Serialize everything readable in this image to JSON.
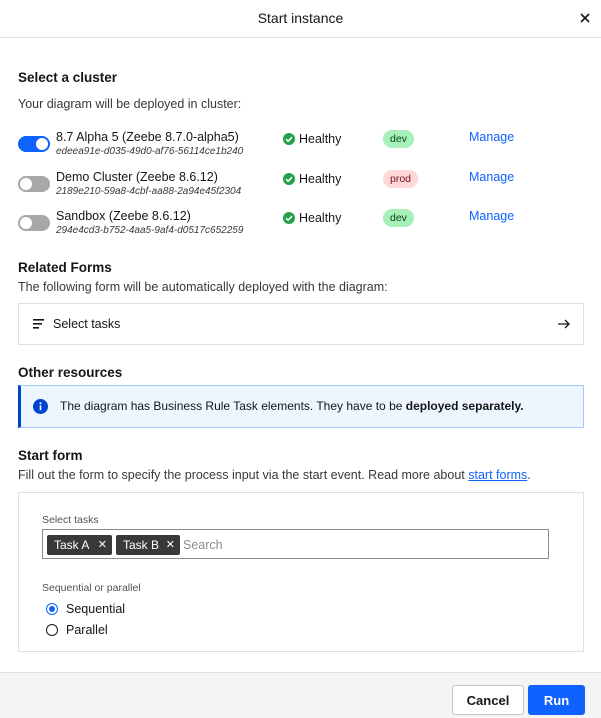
{
  "modal": {
    "title": "Start instance",
    "close_icon": "close-icon"
  },
  "cluster_section": {
    "title": "Select a cluster",
    "helper": "Your diagram will be deployed in cluster:",
    "clusters": [
      {
        "name": "8.7 Alpha 5 (Zeebe 8.7.0-alpha5)",
        "id": "edeea91e-d035-49d0-af76-56114ce1b240",
        "enabled": true,
        "health": "Healthy",
        "tag": "dev",
        "manage_label": "Manage"
      },
      {
        "name": "Demo Cluster (Zeebe 8.6.12)",
        "id": "2189e210-59a8-4cbf-aa88-2a94e45f2304",
        "enabled": false,
        "health": "Healthy",
        "tag": "prod",
        "manage_label": "Manage"
      },
      {
        "name": "Sandbox (Zeebe 8.6.12)",
        "id": "294e4cd3-b752-4aa5-9af4-d0517c652259",
        "enabled": false,
        "health": "Healthy",
        "tag": "dev",
        "manage_label": "Manage"
      }
    ]
  },
  "related_forms": {
    "title": "Related Forms",
    "helper": "The following form will be automatically deployed with the diagram:",
    "form_label": "Select tasks"
  },
  "other_resources": {
    "title": "Other resources",
    "notice_text": "The diagram has Business Rule Task elements. They have to be ",
    "notice_bold": "deployed separately."
  },
  "start_form": {
    "title": "Start form",
    "helper_prefix": "Fill out the form to specify the process input via the start event. Read more about ",
    "helper_link": "start forms",
    "helper_suffix": ".",
    "select_label": "Select tasks",
    "chips": [
      "Task A",
      "Task B"
    ],
    "search_placeholder": "Search",
    "radio_group_label": "Sequential or parallel",
    "radio_options": [
      "Sequential",
      "Parallel"
    ],
    "radio_selected": "Sequential"
  },
  "footer": {
    "cancel_label": "Cancel",
    "run_label": "Run"
  },
  "colors": {
    "primary": "#0f62fe",
    "healthy_green": "#24a148",
    "dev_tag_bg": "#a7f0ba",
    "prod_tag_bg": "#ffd7d9",
    "notice_bg": "#edf5ff"
  }
}
